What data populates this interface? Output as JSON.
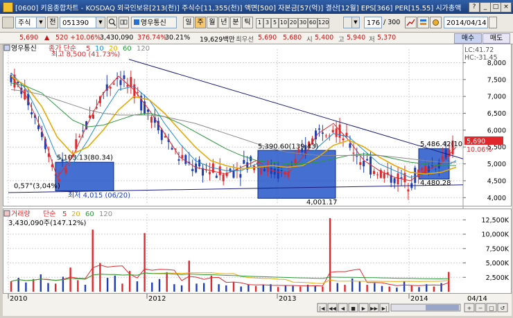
{
  "window": {
    "title": "[0600] 키움종합차트 - KOSDAQ 외국인보유[213(천)] 주식수[11,355(천)] 액면[500] 자본금[57(억)] 결산[12월] EPS[366] PER[15.55] 시가총액"
  },
  "toolbar": {
    "stock_type": "주식",
    "prefix_label": "전",
    "stock_code": "051390",
    "stock_name": "영우통신",
    "period_buttons": [
      "일",
      "주",
      "월",
      "년",
      "분",
      "틱"
    ],
    "active_period": "주",
    "interval_buttons": [
      "1",
      "3",
      "5",
      "10",
      "20",
      "30",
      "60",
      "120"
    ],
    "count_value": "176",
    "count_total": "/ 300",
    "date_value": "2014/04/14",
    "sell_tab": "매수",
    "buy_tab": "매도"
  },
  "quote_bar": {
    "price": "5,690",
    "change": "520 +10.06%",
    "volume": "3,430,090",
    "vol_ratio": "376.74%",
    "turnover": "30.21%",
    "amount": "19,629백만",
    "best_ask_label": "최우선",
    "best_ask": "5,690",
    "best_bid": "5,680",
    "open_label": "시",
    "open": "5,400",
    "high_label": "고",
    "high": "5,940",
    "low_label": "저",
    "low": "5,370"
  },
  "price_panel": {
    "legend_name": "영우통신",
    "legend_ma": "종가 단순",
    "ma_periods": [
      "5",
      "10",
      "20",
      "60",
      "120"
    ],
    "lc": "LC:41.72",
    "hc": "HC:-31.45",
    "current_price_tag": "5,690",
    "current_change_tag": "10.06%",
    "annotations": {
      "high_max": "최고 8,500 (41.73%)",
      "box1_high": "5,103.13(80.34)",
      "left_low": "0,57°(3,04%)",
      "low_min": "최저 4,015 (06/20)",
      "box2_high": "5,390.60(139.43)",
      "box2_low": "4,001.17",
      "box3_high": "5,486.42(10",
      "box3_low": "4,480.28"
    }
  },
  "volume_panel": {
    "legend_name": "거래량",
    "legend_ma": "단순",
    "ma_periods": [
      "5",
      "20",
      "60",
      "120"
    ],
    "last_volume": "3,430,090주(147.12%)"
  },
  "x_axis": {
    "labels": [
      "2010",
      "2012",
      "2013",
      "2014"
    ],
    "right_label": "04/14"
  },
  "colors": {
    "up": "#e0282c",
    "down": "#1e3cb4",
    "ma5": "#e0282c",
    "ma10": "#1e8ad0",
    "ma20": "#e8a800",
    "ma60": "#2a9a3c",
    "ma120": "#8a8a8a",
    "box_fill": "#2456c8",
    "trendline": "#1a1a80"
  },
  "chart_data": [
    {
      "type": "candlestick",
      "title": "영우통신",
      "ylim": [
        3800,
        8400
      ],
      "y_ticks": [
        4000,
        4500,
        5000,
        5500,
        6000,
        6500,
        7000,
        7500,
        8000
      ],
      "y_tick_labels": [
        "4,000",
        "4,500",
        "5,000",
        "5,500",
        "6,000",
        "6,500",
        "7,000",
        "7,500",
        "8,000"
      ],
      "x_ticks": [
        "2010",
        "2012",
        "2013",
        "2014"
      ],
      "series": [
        {
          "name": "5",
          "type": "line",
          "values": [
            7600,
            7000,
            6000,
            4600,
            5200,
            6200,
            7100,
            7600,
            7200,
            6600,
            5900,
            5200,
            4900,
            4800,
            4700,
            4900,
            5100,
            4800,
            4700,
            5200,
            5900,
            6200,
            5700,
            5100,
            4800,
            4600,
            4500,
            4800,
            5000,
            5500
          ]
        },
        {
          "name": "10",
          "type": "line",
          "values": [
            7700,
            7200,
            6300,
            5200,
            5000,
            5700,
            6500,
            7200,
            7300,
            6900,
            6200,
            5600,
            5100,
            4900,
            4800,
            4800,
            5000,
            4900,
            4800,
            5000,
            5500,
            5900,
            5800,
            5400,
            5000,
            4800,
            4600,
            4700,
            4850,
            5100
          ]
        },
        {
          "name": "20",
          "type": "line",
          "values": [
            7600,
            7300,
            6700,
            5800,
            5300,
            5500,
            6000,
            6600,
            7000,
            6900,
            6500,
            6000,
            5500,
            5100,
            4950,
            4850,
            4900,
            4950,
            4900,
            4950,
            5200,
            5550,
            5700,
            5500,
            5200,
            4950,
            4750,
            4700,
            4750,
            4900
          ]
        },
        {
          "name": "60",
          "type": "line",
          "values": [
            7400,
            7300,
            7100,
            6700,
            6300,
            6100,
            6150,
            6300,
            6450,
            6500,
            6400,
            6200,
            5950,
            5700,
            5450,
            5250,
            5100,
            5050,
            5000,
            5000,
            5050,
            5150,
            5250,
            5300,
            5250,
            5150,
            5050,
            5000,
            4950,
            4950
          ]
        },
        {
          "name": "120",
          "type": "line",
          "values": [
            7200,
            7150,
            7050,
            6900,
            6750,
            6600,
            6500,
            6450,
            6450,
            6450,
            6400,
            6300,
            6200,
            6050,
            5900,
            5750,
            5600,
            5450,
            5350,
            5300,
            5250,
            5250,
            5250,
            5250,
            5250,
            5200,
            5150,
            5100,
            5050,
            5050
          ]
        }
      ],
      "high": 8500,
      "low": 4015,
      "last": 5690
    },
    {
      "type": "bar",
      "title": "거래량",
      "ylim": [
        0,
        13500
      ],
      "unit": "K",
      "y_ticks": [
        2500,
        5000,
        7500,
        10000,
        12500
      ],
      "y_tick_labels": [
        "2,500K",
        "5,000K",
        "7,500K",
        "10,000K",
        "12,500K"
      ],
      "values_k": [
        1800,
        2400,
        1600,
        2200,
        3000,
        1500,
        1400,
        2600,
        4200,
        2000,
        1200,
        10800,
        5000,
        2400,
        2800,
        1400,
        3600,
        1800,
        10200,
        1600,
        2200,
        3400,
        1300,
        1100,
        5400,
        1400,
        1500,
        2800,
        1300,
        1100,
        1700,
        900,
        1200,
        1000,
        1200,
        1300,
        800,
        1100,
        1000,
        900,
        1200,
        1000,
        900,
        12800,
        1500,
        1200,
        2300,
        1800,
        1200,
        1500,
        1000,
        900,
        700,
        1800,
        1100,
        800,
        1300,
        900,
        1500,
        3430
      ]
    }
  ]
}
